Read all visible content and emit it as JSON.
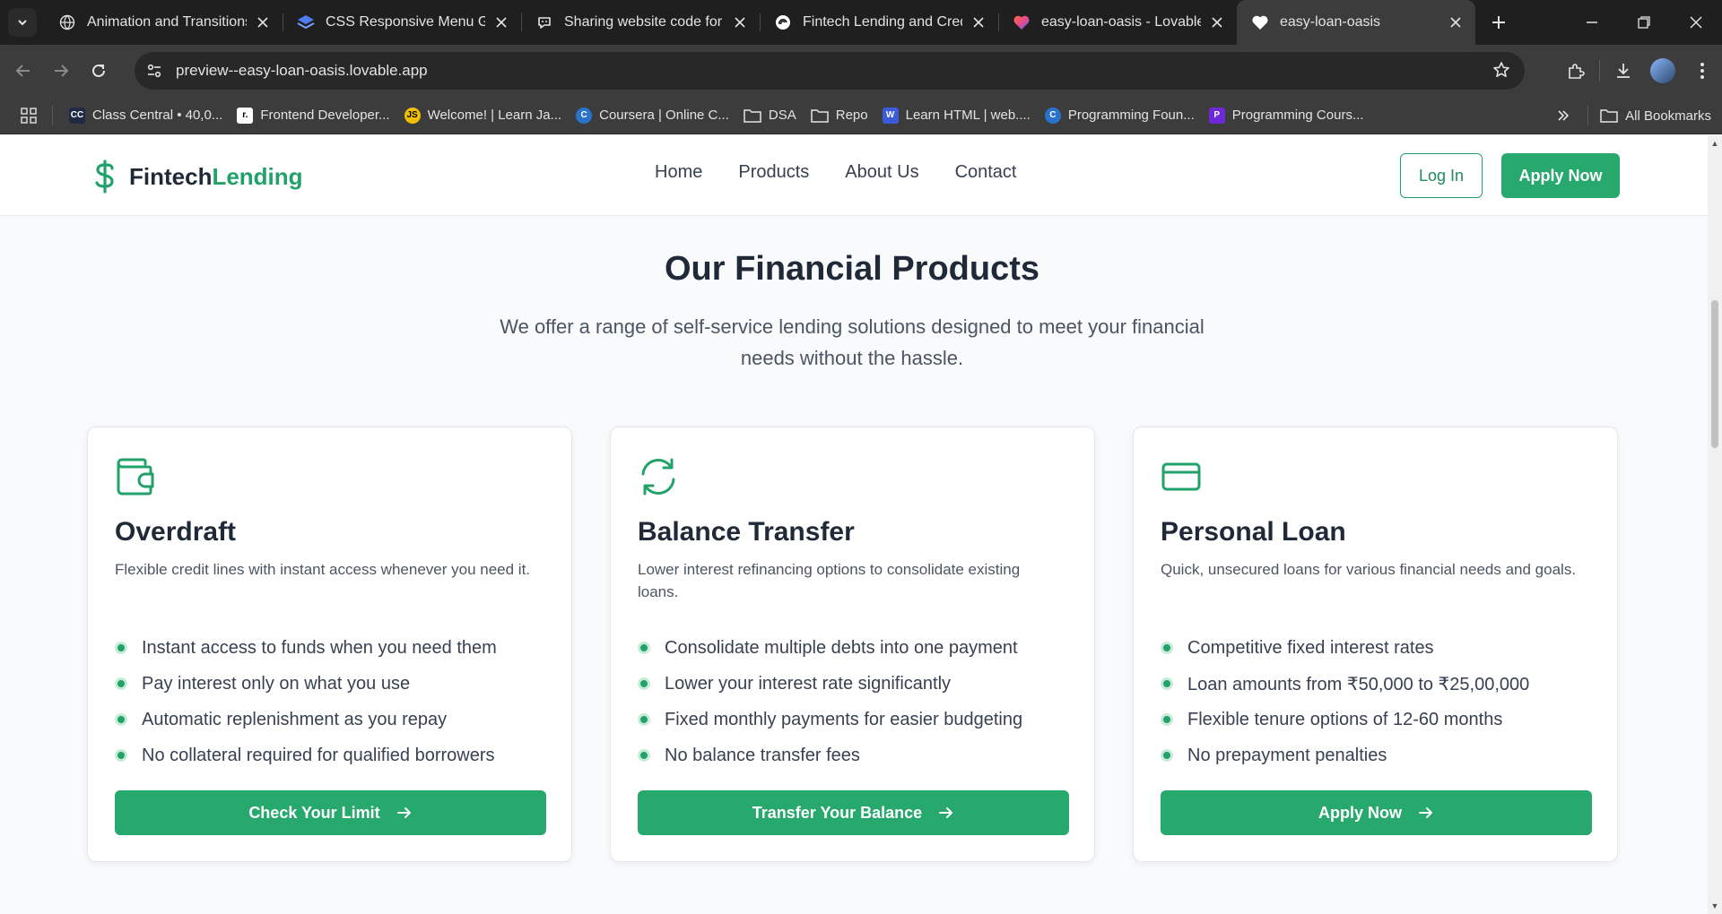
{
  "browser": {
    "tabs": [
      {
        "title": "Animation and Transitions",
        "icon": "globe-icon",
        "active": false
      },
      {
        "title": "CSS Responsive Menu Gen",
        "icon": "layers-icon",
        "active": false
      },
      {
        "title": "Sharing website code for a",
        "icon": "chat-icon",
        "active": false
      },
      {
        "title": "Fintech Lending and Credit",
        "icon": "swirl-icon",
        "active": false
      },
      {
        "title": "easy-loan-oasis - Lovable",
        "icon": "heart-color-icon",
        "active": false
      },
      {
        "title": "easy-loan-oasis",
        "icon": "heart-white-icon",
        "active": true
      }
    ],
    "url": "preview--easy-loan-oasis.lovable.app",
    "bookmarks": [
      {
        "label": "Class Central • 40,0...",
        "icon": "CC",
        "bg": "#1f2a44",
        "fg": "#ffffff"
      },
      {
        "label": "Frontend Developer...",
        "icon": "r.",
        "bg": "#ffffff",
        "fg": "#000000"
      },
      {
        "label": "Welcome! | Learn Ja...",
        "icon": "JS",
        "bg": "#f0c000",
        "fg": "#000000"
      },
      {
        "label": "Coursera | Online C...",
        "icon": "C",
        "bg": "#2a73cc",
        "fg": "#ffffff"
      },
      {
        "label": "DSA",
        "icon": "folder",
        "bg": "",
        "fg": ""
      },
      {
        "label": "Repo",
        "icon": "folder",
        "bg": "",
        "fg": ""
      },
      {
        "label": "Learn HTML | web....",
        "icon": "W",
        "bg": "#3b5bdb",
        "fg": "#ffffff"
      },
      {
        "label": "Programming Foun...",
        "icon": "C",
        "bg": "#2a73cc",
        "fg": "#ffffff"
      },
      {
        "label": "Programming Cours...",
        "icon": "P",
        "bg": "#6d28d9",
        "fg": "#ffffff"
      }
    ],
    "all_bookmarks": "All Bookmarks"
  },
  "header": {
    "brand_main": "Fintech",
    "brand_accent": "Lending",
    "nav": [
      "Home",
      "Products",
      "About Us",
      "Contact"
    ],
    "login": "Log In",
    "apply": "Apply Now"
  },
  "section": {
    "title": "Our Financial Products",
    "subtitle": "We offer a range of self-service lending solutions designed to meet your financial needs without the hassle."
  },
  "products": [
    {
      "icon": "wallet-icon",
      "title": "Overdraft",
      "description": "Flexible credit lines with instant access whenever you need it.",
      "features": [
        "Instant access to funds when you need them",
        "Pay interest only on what you use",
        "Automatic replenishment as you repay",
        "No collateral required for qualified borrowers"
      ],
      "cta": "Check Your Limit"
    },
    {
      "icon": "refresh-icon",
      "title": "Balance Transfer",
      "description": "Lower interest refinancing options to consolidate existing loans.",
      "features": [
        "Consolidate multiple debts into one payment",
        "Lower your interest rate significantly",
        "Fixed monthly payments for easier budgeting",
        "No balance transfer fees"
      ],
      "cta": "Transfer Your Balance"
    },
    {
      "icon": "credit-card-icon",
      "title": "Personal Loan",
      "description": "Quick, unsecured loans for various financial needs and goals.",
      "features": [
        "Competitive fixed interest rates",
        "Loan amounts from ₹50,000 to ₹25,00,000",
        "Flexible tenure options of 12-60 months",
        "No prepayment penalties"
      ],
      "cta": "Apply Now"
    }
  ],
  "colors": {
    "accent": "#22a26b",
    "button": "#27a86d",
    "heading": "#1f2937"
  }
}
